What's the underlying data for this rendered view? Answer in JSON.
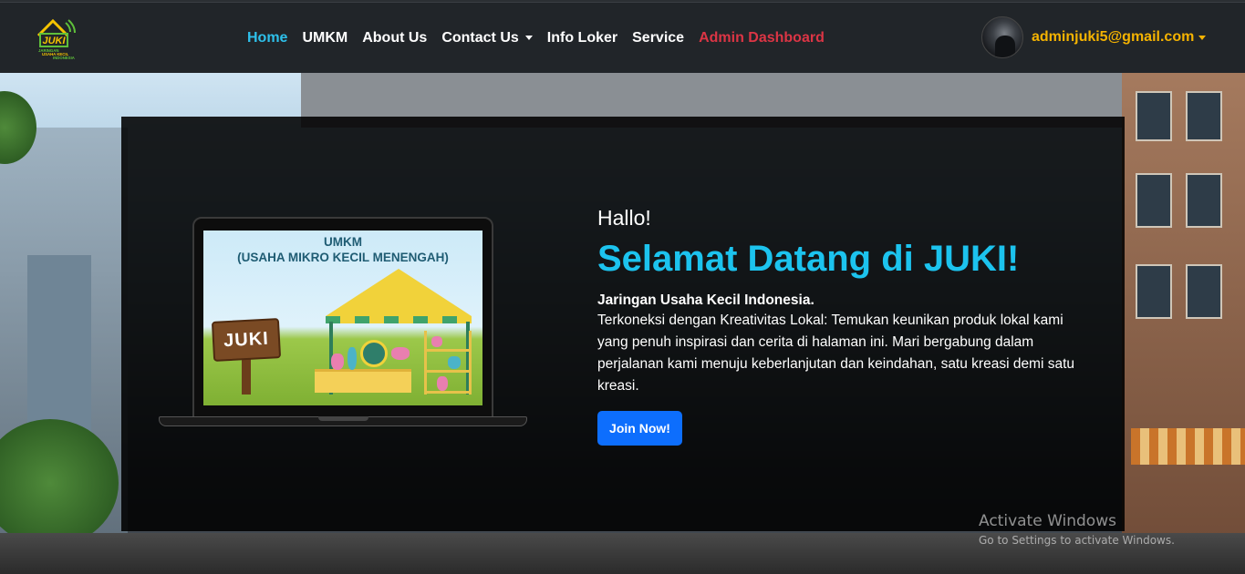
{
  "brand": {
    "logo_text": "JUKI",
    "logo_tagline": "JARINGAN USAHA KECIL INDONESIA",
    "colors": {
      "logo_green": "#5fbf3a",
      "logo_yellow": "#f5c400",
      "accent": "#1cc3ee"
    }
  },
  "nav": {
    "items": [
      {
        "label": "Home",
        "state": "active"
      },
      {
        "label": "UMKM"
      },
      {
        "label": "About Us"
      },
      {
        "label": "Contact Us",
        "dropdown": true
      },
      {
        "label": "Info Loker"
      },
      {
        "label": "Service"
      },
      {
        "label": "Admin Dashboard",
        "color": "#dc3545"
      }
    ],
    "user": {
      "email": "adminjuki5@gmail.com",
      "email_color": "#f5b301",
      "avatar_icon": "user-avatar"
    }
  },
  "hero": {
    "greeting": "Hallo!",
    "headline": "Selamat Datang di JUKI!",
    "subheading": "Jaringan Usaha Kecil Indonesia.",
    "description": "Terkoneksi dengan Kreativitas Lokal: Temukan keunikan produk lokal kami yang penuh inspirasi dan cerita di halaman ini. Mari bergabung dalam perjalanan kami menuju keberlanjutan dan keindahan, satu kreasi demi satu kreasi.",
    "cta_label": "Join Now!",
    "illustration": {
      "title_line1": "UMKM",
      "title_line2": "(USAHA MIKRO KECIL MENENGAH)",
      "sign_text": "JUKI"
    }
  },
  "watermark": {
    "title": "Activate Windows",
    "subtitle": "Go to Settings to activate Windows."
  }
}
